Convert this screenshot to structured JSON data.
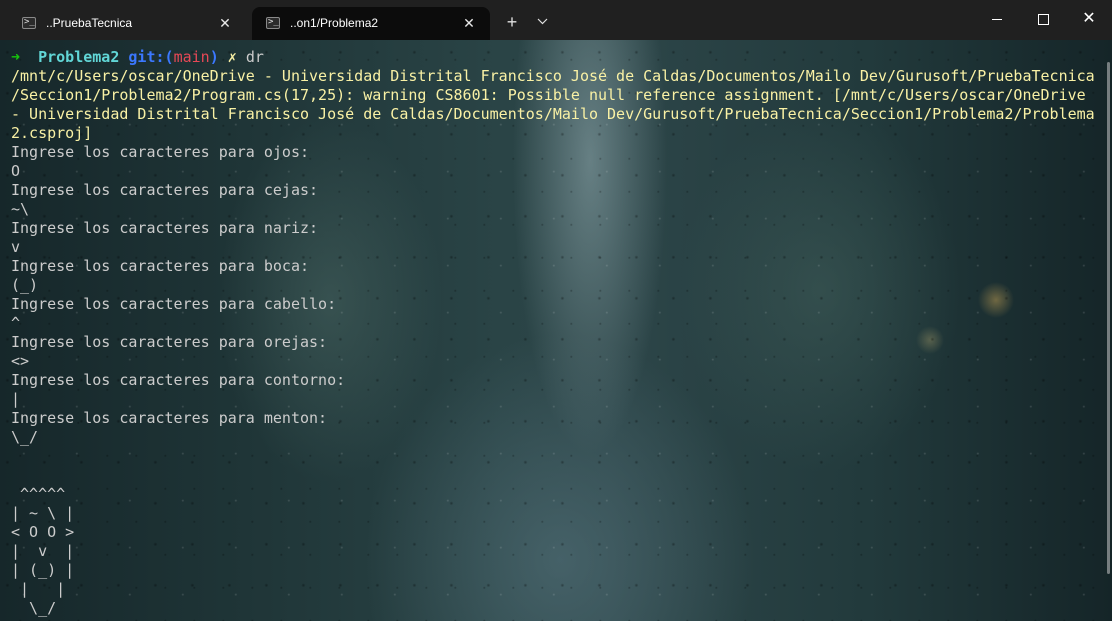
{
  "tabs": [
    {
      "title": "..PruebaTecnica",
      "icon": "terminal-icon",
      "close": "✕",
      "active": false
    },
    {
      "title": "..on1/Problema2",
      "icon": "terminal-icon",
      "close": "✕",
      "active": true
    }
  ],
  "tabbar": {
    "new_tab": "+",
    "dropdown": "⌄"
  },
  "window_controls": {
    "close": "✕"
  },
  "prompt": {
    "arrow": "➜",
    "directory": "Problema2",
    "git_prefix": "git:(",
    "branch": "main",
    "git_suffix": ")",
    "dirty_marker": "✗",
    "command": "dr"
  },
  "warning_lines": [
    "/mnt/c/Users/oscar/OneDrive - Universidad Distrital Francisco José de Caldas/Documentos/Mailo Dev/Gurusoft/PruebaTecnica",
    "/Seccion1/Problema2/Program.cs(17,25): warning CS8601: Possible null reference assignment. [/mnt/c/Users/oscar/OneDrive",
    "- Universidad Distrital Francisco José de Caldas/Documentos/Mailo Dev/Gurusoft/PruebaTecnica/Seccion1/Problema2/Problema",
    "2.csproj]"
  ],
  "prompts": [
    {
      "question": "Ingrese los caracteres para ojos:",
      "answer": "O"
    },
    {
      "question": "Ingrese los caracteres para cejas:",
      "answer": "~\\"
    },
    {
      "question": "Ingrese los caracteres para nariz:",
      "answer": "v"
    },
    {
      "question": "Ingrese los caracteres para boca:",
      "answer": "(_)"
    },
    {
      "question": "Ingrese los caracteres para cabello:",
      "answer": "^"
    },
    {
      "question": "Ingrese los caracteres para orejas:",
      "answer": "<>"
    },
    {
      "question": "Ingrese los caracteres para contorno:",
      "answer": "|"
    },
    {
      "question": "Ingrese los caracteres para menton:",
      "answer": "\\_/"
    }
  ],
  "face_art": [
    " ^^^^^",
    "| ~ \\ |",
    "< O O >",
    "|  v  |",
    "| (_) |",
    " |   |",
    "  \\_/"
  ],
  "colors": {
    "prompt_arrow": "#16c60c",
    "prompt_directory": "#61d6d6",
    "prompt_git": "#3b78ff",
    "prompt_branch": "#e74856",
    "warning_text": "#f9f1a5",
    "default_text": "#cccccc"
  }
}
